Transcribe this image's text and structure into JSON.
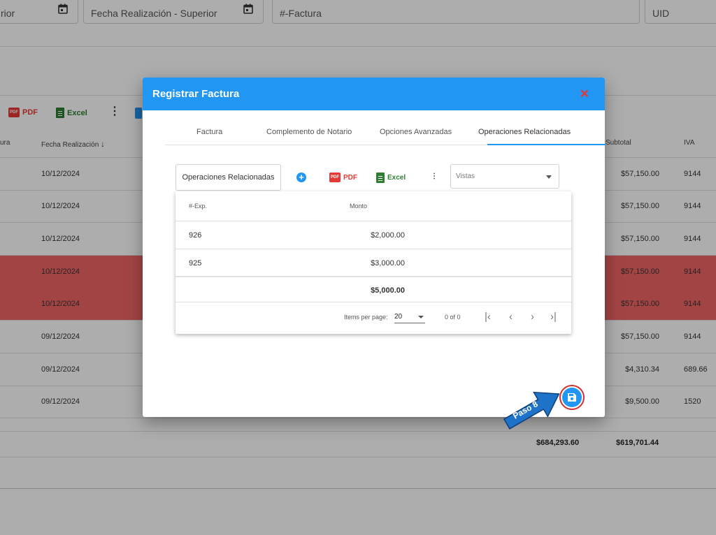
{
  "filters": [
    {
      "value": "rior",
      "has_calendar": true
    },
    {
      "value": "Fecha Realización - Superior",
      "has_calendar": true
    },
    {
      "value": "#-Factura",
      "has_calendar": false
    },
    {
      "value": "UID",
      "has_calendar": false
    }
  ],
  "bg_toolbar": {
    "pdf": "PDF",
    "excel": "Excel"
  },
  "bg_table": {
    "headers": [
      "ura",
      "Fecha Realización",
      "Subtotal",
      "IVA"
    ],
    "rows": [
      {
        "fecha": "10/12/2024",
        "subtotal": "$57,150.00",
        "iva": "9144",
        "highlight": false
      },
      {
        "fecha": "10/12/2024",
        "subtotal": "$57,150.00",
        "iva": "9144",
        "highlight": false
      },
      {
        "fecha": "10/12/2024",
        "subtotal": "$57,150.00",
        "iva": "9144",
        "highlight": false
      },
      {
        "fecha": "10/12/2024",
        "subtotal": "$57,150.00",
        "iva": "9144",
        "highlight": true
      },
      {
        "fecha": "10/12/2024",
        "subtotal": "$57,150.00",
        "iva": "9144",
        "highlight": true
      },
      {
        "fecha": "09/12/2024",
        "subtotal": "$57,150.00",
        "iva": "9144",
        "highlight": false
      },
      {
        "fecha": "09/12/2024",
        "subtotal": "$4,310.34",
        "iva": "689.66",
        "highlight": false
      },
      {
        "fecha": "09/12/2024",
        "subtotal": "$9,500.00",
        "iva": "1520",
        "highlight": false
      }
    ],
    "totals": {
      "total_a": "$684,293.60",
      "total_b": "$619,701.44"
    }
  },
  "dialog": {
    "title": "Registrar Factura",
    "close": "✕",
    "tabs": [
      "Factura",
      "Complemento de Notario",
      "Opciones Avanzadas",
      "Operaciones Relacionadas"
    ],
    "active_tab": 3,
    "toolbar": {
      "ops_button": "Operaciones Relacionadas",
      "pdf": "PDF",
      "excel": "Excel",
      "views_placeholder": "Vistas"
    },
    "table": {
      "headers": {
        "exp": "#-Exp.",
        "monto": "Monto"
      },
      "rows": [
        {
          "exp": "926",
          "monto": "$2,000.00"
        },
        {
          "exp": "925",
          "monto": "$3,000.00"
        }
      ],
      "total": "$5,000.00"
    },
    "paginator": {
      "items_label": "Items per page:",
      "page_size": "20",
      "range": "0 of 0"
    }
  },
  "callout": {
    "label": "Paso 8",
    "color": "#1e73c8"
  },
  "colors": {
    "primary": "#2196f3",
    "danger": "#e53935",
    "excel": "#2e7d32",
    "highlight_row": "#f06565"
  }
}
